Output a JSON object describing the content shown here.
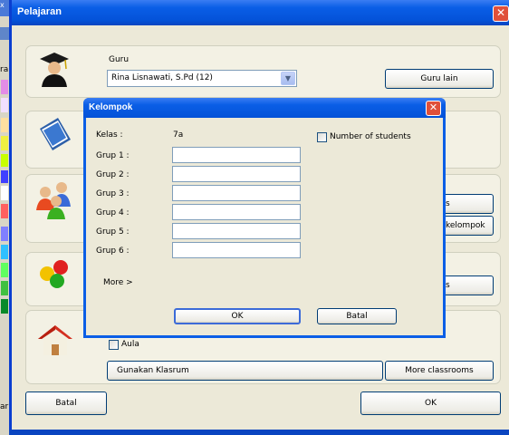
{
  "window": {
    "title": "Pelajaran"
  },
  "teacher": {
    "label": "Guru",
    "selected": "Rina Lisnawati, S.Pd (12)",
    "other_button": "Guru lain"
  },
  "classrooms": {
    "aula_label": "Aula",
    "use_classroom_button": "Gunakan Klasrum",
    "more_classrooms_button": "More classrooms"
  },
  "hidden_buttons": {
    "students_partial": "s",
    "groups_partial": "kelompok",
    "colors_partial": "s"
  },
  "footer": {
    "cancel": "Batal",
    "ok": "OK"
  },
  "left_partial_texts": [
    "ra",
    "ar"
  ],
  "dialog": {
    "title": "Kelompok",
    "class_label": "Kelas :",
    "class_value": "7a",
    "number_of_students": "Number of students",
    "groups": [
      {
        "label": "Grup 1 :",
        "value": ""
      },
      {
        "label": "Grup 2 :",
        "value": ""
      },
      {
        "label": "Grup 3 :",
        "value": ""
      },
      {
        "label": "Grup 4 :",
        "value": ""
      },
      {
        "label": "Grup 5 :",
        "value": ""
      },
      {
        "label": "Grup 6 :",
        "value": ""
      }
    ],
    "more": "More >",
    "ok": "OK",
    "cancel": "Batal"
  },
  "colors": {
    "xp_blue": "#0a5ee6",
    "panel": "#f3f1e4",
    "face": "#ece9d8",
    "close_red": "#e0503a"
  },
  "icons": [
    "graduate-icon",
    "book-icon",
    "people-group-icon",
    "colored-balls-icon",
    "house-icon",
    "close-icon",
    "chevron-down-icon"
  ]
}
